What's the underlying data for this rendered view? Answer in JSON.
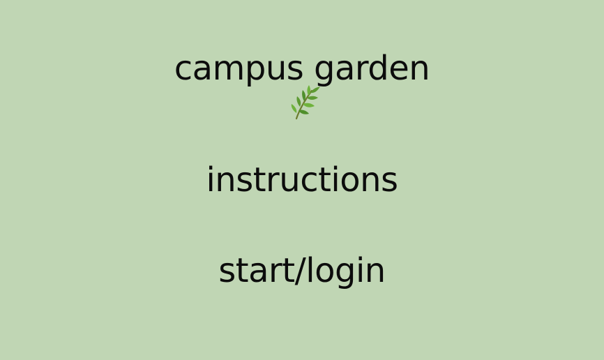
{
  "screen": {
    "background": "#c0d6b4",
    "text_color": "#0c0c0c"
  },
  "title": {
    "text": "campus garden",
    "icon": "herb-leaf-icon"
  },
  "menu": {
    "instructions_label": "instructions",
    "start_label": "start/login"
  }
}
